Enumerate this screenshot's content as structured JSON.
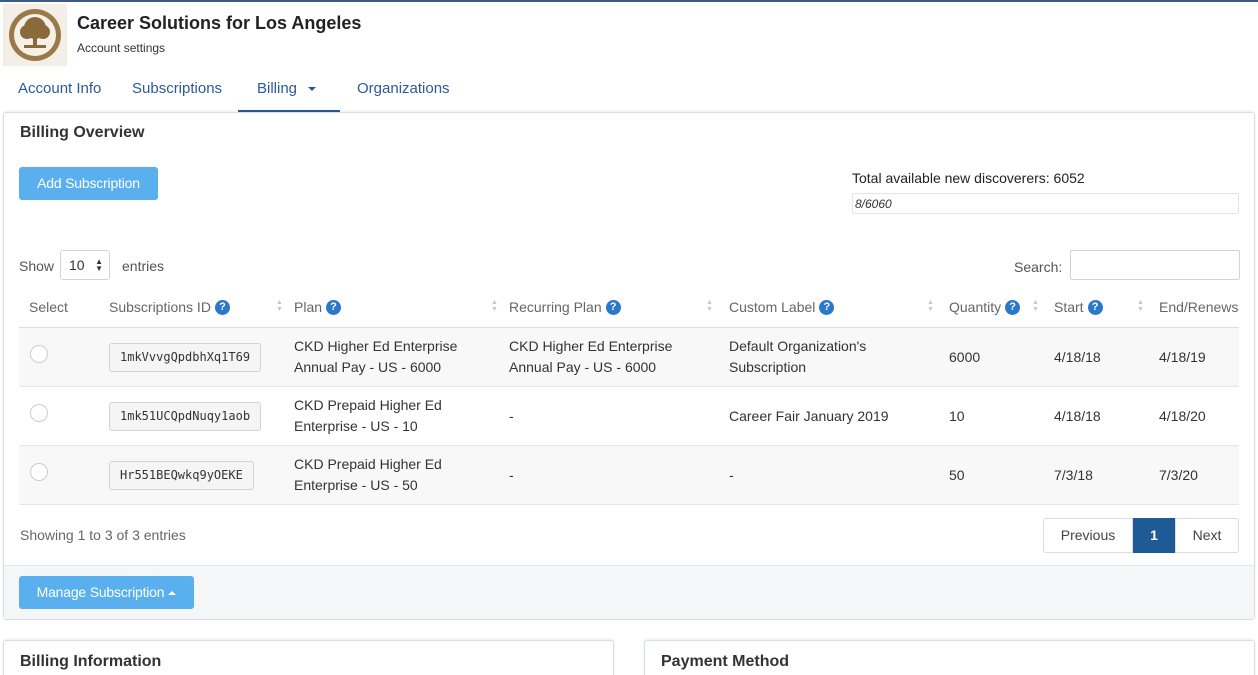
{
  "org": {
    "name": "Career Solutions for Los Angeles",
    "subtitle": "Account settings"
  },
  "tabs": [
    {
      "label": "Account Info"
    },
    {
      "label": "Subscriptions"
    },
    {
      "label": "Billing",
      "active": true
    },
    {
      "label": "Organizations"
    }
  ],
  "overview": {
    "title": "Billing Overview",
    "add_button": "Add Subscription",
    "total_label": "Total available new discoverers: 6052",
    "progress_text": "8/6060",
    "progress_fraction": 0.0013
  },
  "table_controls": {
    "show": "Show",
    "entries_count": "10",
    "entries": "entries",
    "search_label": "Search:",
    "search_value": ""
  },
  "columns": [
    "Select",
    "Subscriptions ID",
    "Plan",
    "Recurring Plan",
    "Custom Label",
    "Quantity",
    "Start",
    "End/Renews"
  ],
  "rows": [
    {
      "id": "1mkVvvgQpdbhXq1T69",
      "plan_1": "CKD Higher Ed Enterprise",
      "plan_2": "Annual Pay - US - 6000",
      "rec_1": "CKD Higher Ed Enterprise",
      "rec_2": "Annual Pay - US - 6000",
      "label_1": "Default Organization's",
      "label_2": "Subscription",
      "quantity": "6000",
      "start": "4/18/18",
      "end": "4/18/19"
    },
    {
      "id": "1mk51UCQpdNuqy1aob",
      "plan_1": "CKD Prepaid Higher Ed",
      "plan_2": "Enterprise - US - 10",
      "rec_1": "-",
      "rec_2": "",
      "label_1": "Career Fair January 2019",
      "label_2": "",
      "quantity": "10",
      "start": "4/18/18",
      "end": "4/18/20"
    },
    {
      "id": "Hr551BEQwkq9yOEKE",
      "plan_1": "CKD Prepaid Higher Ed",
      "plan_2": "Enterprise - US - 50",
      "rec_1": "-",
      "rec_2": "",
      "label_1": "-",
      "label_2": "",
      "quantity": "50",
      "start": "7/3/18",
      "end": "7/3/20"
    }
  ],
  "footer": {
    "showing": "Showing 1 to 3 of 3 entries",
    "previous": "Previous",
    "page": "1",
    "next": "Next",
    "manage_button": "Manage Subscription"
  },
  "bottom_panels": {
    "billing_info": "Billing Information",
    "payment_method": "Payment Method"
  },
  "colors": {
    "primary": "#2a5a9a",
    "button": "#5ab0ef",
    "help_icon": "#2c78c8",
    "page_active": "#1d5a96"
  },
  "icons": {
    "help": "question-circle-icon",
    "sort": "sort-arrows-icon",
    "logo": "tree-logo-icon"
  }
}
